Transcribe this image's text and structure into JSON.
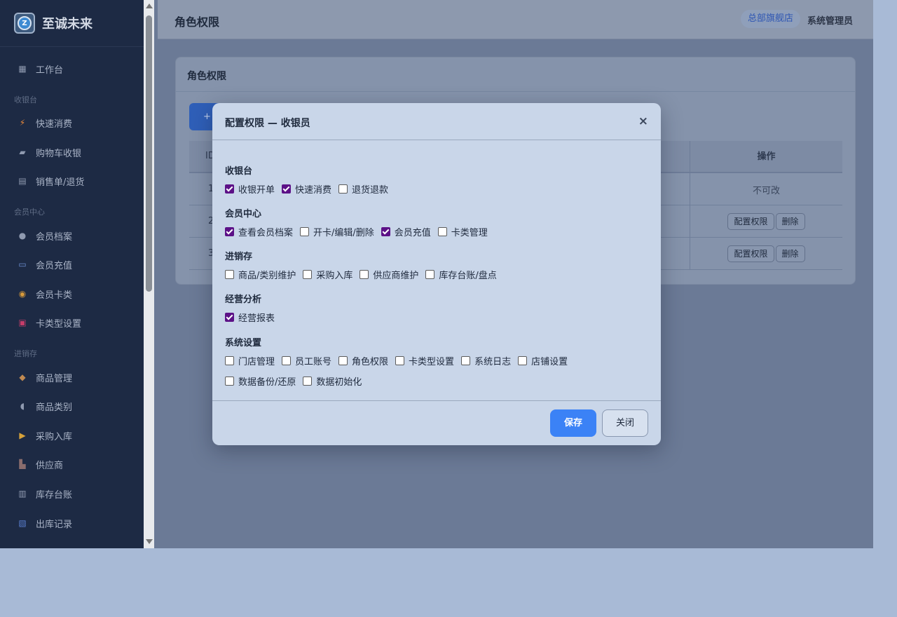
{
  "brand": {
    "name": "至诚未来",
    "logo_letter": "Z"
  },
  "sidebar": {
    "items": [
      {
        "label": "工作台",
        "icon": "grid-icon"
      },
      {
        "section": "收银台"
      },
      {
        "label": "快速消费",
        "icon": "lightning-icon"
      },
      {
        "label": "购物车收银",
        "icon": "cart-icon"
      },
      {
        "label": "销售单/退货",
        "icon": "receipt-icon"
      },
      {
        "section": "会员中心"
      },
      {
        "label": "会员档案",
        "icon": "user-icon"
      },
      {
        "label": "会员充值",
        "icon": "card-icon"
      },
      {
        "label": "会员卡类",
        "icon": "medal-icon"
      },
      {
        "label": "卡类型设置",
        "icon": "card-type-icon"
      },
      {
        "section": "进销存"
      },
      {
        "label": "商品管理",
        "icon": "box-icon"
      },
      {
        "label": "商品类别",
        "icon": "tag-icon"
      },
      {
        "label": "采购入库",
        "icon": "truck-icon"
      },
      {
        "label": "供应商",
        "icon": "factory-icon"
      },
      {
        "label": "库存台账",
        "icon": "ledger-icon"
      },
      {
        "label": "出库记录",
        "icon": "outbound-icon"
      }
    ]
  },
  "header": {
    "title": "角色权限",
    "store_badge": "总部旗舰店",
    "user": "系统管理员"
  },
  "card": {
    "title": "角色权限",
    "add_button": "+",
    "table": {
      "id_header": "ID",
      "op_header": "操作",
      "rows": [
        {
          "id": "1",
          "op_text": "不可改"
        },
        {
          "id": "2",
          "buttons": [
            "配置权限",
            "删除"
          ]
        },
        {
          "id": "3",
          "buttons": [
            "配置权限",
            "删除"
          ]
        }
      ]
    }
  },
  "modal": {
    "title": "配置权限 — 收银员",
    "close_icon": "×",
    "groups": [
      {
        "title": "收银台",
        "perms": [
          {
            "label": "收银开单",
            "checked": true
          },
          {
            "label": "快速消费",
            "checked": true
          },
          {
            "label": "退货退款",
            "checked": false
          }
        ]
      },
      {
        "title": "会员中心",
        "perms": [
          {
            "label": "查看会员档案",
            "checked": true
          },
          {
            "label": "开卡/编辑/删除",
            "checked": false
          },
          {
            "label": "会员充值",
            "checked": true
          },
          {
            "label": "卡类管理",
            "checked": false
          }
        ]
      },
      {
        "title": "进销存",
        "perms": [
          {
            "label": "商品/类别维护",
            "checked": false
          },
          {
            "label": "采购入库",
            "checked": false
          },
          {
            "label": "供应商维护",
            "checked": false
          },
          {
            "label": "库存台账/盘点",
            "checked": false
          }
        ]
      },
      {
        "title": "经营分析",
        "perms": [
          {
            "label": "经营报表",
            "checked": true
          }
        ]
      },
      {
        "title": "系统设置",
        "perms": [
          {
            "label": "门店管理",
            "checked": false
          },
          {
            "label": "员工账号",
            "checked": false
          },
          {
            "label": "角色权限",
            "checked": false
          },
          {
            "label": "卡类型设置",
            "checked": false
          },
          {
            "label": "系统日志",
            "checked": false
          },
          {
            "label": "店铺设置",
            "checked": false
          },
          {
            "label": "数据备份/还原",
            "checked": false
          },
          {
            "label": "数据初始化",
            "checked": false
          }
        ]
      }
    ],
    "save_label": "保存",
    "close_label": "关闭"
  },
  "colors": {
    "accent": "#3b82f6",
    "checkbox": "#5c1187",
    "sidebar_bg": "#1d2a44"
  }
}
